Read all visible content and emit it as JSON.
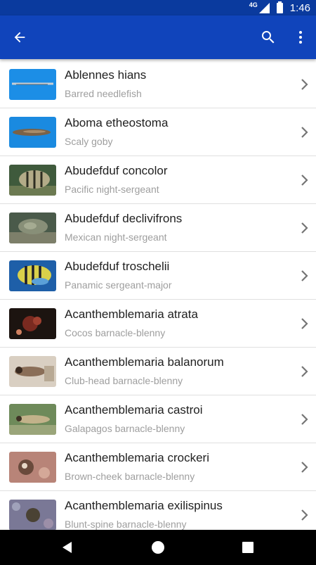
{
  "status_bar": {
    "network": "4G",
    "time": "1:46",
    "icons": [
      "signal-icon",
      "battery-icon"
    ]
  },
  "app_bar": {
    "color": "#1044bb",
    "status_color": "#0a3a9e",
    "icons": [
      "arrow-back-icon",
      "search-icon",
      "more-vert-icon"
    ]
  },
  "species": [
    {
      "scientific": "Ablennes hians",
      "common": "Barred needlefish"
    },
    {
      "scientific": "Aboma etheostoma",
      "common": "Scaly goby"
    },
    {
      "scientific": "Abudefduf concolor",
      "common": "Pacific night-sergeant"
    },
    {
      "scientific": "Abudefduf declivifrons",
      "common": "Mexican night-sergeant"
    },
    {
      "scientific": "Abudefduf troschelii",
      "common": "Panamic sergeant-major"
    },
    {
      "scientific": "Acanthemblemaria atrata",
      "common": "Cocos barnacle-blenny"
    },
    {
      "scientific": "Acanthemblemaria balanorum",
      "common": "Club-head barnacle-blenny"
    },
    {
      "scientific": "Acanthemblemaria castroi",
      "common": "Galapagos barnacle-blenny"
    },
    {
      "scientific": "Acanthemblemaria crockeri",
      "common": "Brown-cheek barnacle-blenny"
    },
    {
      "scientific": "Acanthemblemaria exilispinus",
      "common": "Blunt-spine barnacle-blenny"
    }
  ],
  "nav_bar": {
    "icons": [
      "back-triangle-icon",
      "home-circle-icon",
      "recents-square-icon"
    ]
  }
}
